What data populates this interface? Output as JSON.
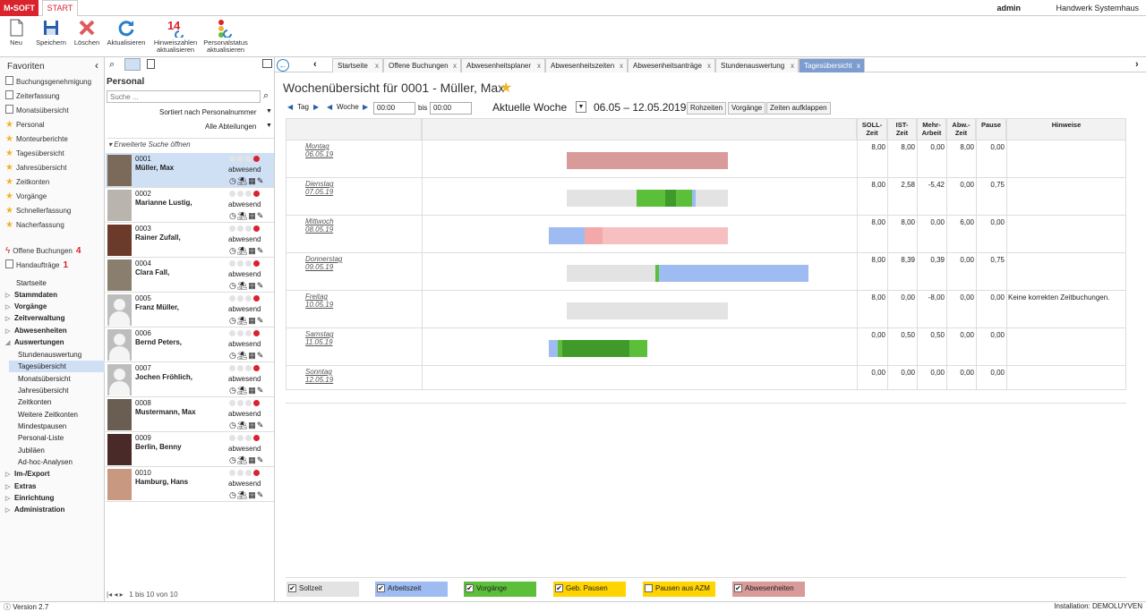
{
  "app": {
    "logo": "M•SOFT",
    "start_tab": "START",
    "user": "admin",
    "company": "Handwerk Systemhaus",
    "version": "Version 2.7",
    "installation": "Installation: DEMOLUYVEN"
  },
  "toolbar": {
    "neu": "Neu",
    "speichern": "Speichern",
    "loeschen": "Löschen",
    "aktualisieren": "Aktualisieren",
    "hinweis1": "Hinweiszahlen",
    "hinweis2": "aktualisieren",
    "pstatus1": "Personalstatus",
    "pstatus2": "aktualisieren"
  },
  "sidebar": {
    "favoriten": "Favoriten",
    "favs": [
      "Buchungsgenehmigung",
      "Zeiterfassung",
      "Monatsübersicht",
      "Personal",
      "Monteurberichte",
      "Tagesübersicht",
      "Jahresübersicht",
      "Zeitkonten",
      "Vorgänge",
      "Schnellerfassung",
      "Nacherfassung"
    ],
    "offene": "Offene Buchungen",
    "offene_count": "4",
    "hand": "Handaufträge",
    "hand_count": "1",
    "nav": [
      "Startseite",
      "Stammdaten",
      "Vorgänge",
      "Zeitverwaltung",
      "Abwesenheiten",
      "Auswertungen"
    ],
    "sub": [
      "Stundenauswertung",
      "Tagesübersicht",
      "Monatsübersicht",
      "Jahresübersicht",
      "Zeitkonten",
      "Weitere Zeitkonten",
      "Mindestpausen",
      "Personal-Liste",
      "Jubiläen",
      "Ad-hoc-Analysen"
    ],
    "nav2": [
      "Im-/Export",
      "Extras",
      "Einrichtung",
      "Administration"
    ]
  },
  "personal": {
    "title": "Personal",
    "search_placeholder": "Suche ...",
    "sort": "Sortiert nach Personalnummer",
    "dept": "Alle Abteilungen",
    "ext_search": "Erweiterte Suche öffnen",
    "pager": "1 bis 10 von 10",
    "rows": [
      {
        "num": "0001",
        "name": "Müller, Max",
        "status": "abwesend"
      },
      {
        "num": "0002",
        "name": "Marianne Lustig,",
        "status": "abwesend"
      },
      {
        "num": "0003",
        "name": "Rainer Zufall,",
        "status": "abwesend"
      },
      {
        "num": "0004",
        "name": "Clara Fall,",
        "status": "abwesend"
      },
      {
        "num": "0005",
        "name": "Franz Müller,",
        "status": "abwesend"
      },
      {
        "num": "0006",
        "name": "Bernd Peters,",
        "status": "abwesend"
      },
      {
        "num": "0007",
        "name": "Jochen Fröhlich,",
        "status": "abwesend"
      },
      {
        "num": "0008",
        "name": "Mustermann, Max",
        "status": "abwesend"
      },
      {
        "num": "0009",
        "name": "Berlin, Benny",
        "status": "abwesend"
      },
      {
        "num": "0010",
        "name": "Hamburg, Hans",
        "status": "abwesend"
      }
    ]
  },
  "tabs": [
    "Startseite",
    "Offene Buchungen",
    "Abwesenheitsplaner",
    "Abwesenheitszeiten",
    "Abwesenheitsanträge",
    "Stundenauswertung",
    "Tagesübersicht"
  ],
  "main": {
    "title": "Wochenübersicht für 0001 - Müller, Max",
    "tag": "Tag",
    "woche": "Woche",
    "from": "00:00",
    "bis": "bis",
    "to": "00:00",
    "week_label": "Aktuelle Woche",
    "range": "06.05 – 12.05.2019",
    "btn_roh": "Rohzeiten",
    "btn_vorg": "Vorgänge",
    "btn_auf": "Zeiten aufklappen"
  },
  "columns": {
    "soll": [
      "SOLL-",
      "Zeit"
    ],
    "ist": [
      "IST-",
      "Zeit"
    ],
    "mehr": [
      "Mehr-",
      "Arbeit"
    ],
    "abw": [
      "Abw.-",
      "Zeit"
    ],
    "pause": "Pause",
    "hinweise": "Hinweise"
  },
  "days": [
    {
      "day": "Montag",
      "date": "06.05.19",
      "soll": "8,00",
      "ist": "8,00",
      "mehr": "0,00",
      "abw": "8,00",
      "pause": "0,00",
      "hint": ""
    },
    {
      "day": "Dienstag",
      "date": "07.05.19",
      "soll": "8,00",
      "ist": "2,58",
      "mehr": "-5,42",
      "abw": "0,00",
      "pause": "0,75",
      "hint": ""
    },
    {
      "day": "Mittwoch",
      "date": "08.05.19",
      "soll": "8,00",
      "ist": "8,00",
      "mehr": "0,00",
      "abw": "6,00",
      "pause": "0,00",
      "hint": ""
    },
    {
      "day": "Donnerstag",
      "date": "09.05.19",
      "soll": "8,00",
      "ist": "8,39",
      "mehr": "0,39",
      "abw": "0,00",
      "pause": "0,75",
      "hint": ""
    },
    {
      "day": "Freitag",
      "date": "10.05.19",
      "soll": "8,00",
      "ist": "0,00",
      "mehr": "-8,00",
      "abw": "0,00",
      "pause": "0,00",
      "hint": "Keine korrekten Zeitbuchungen."
    },
    {
      "day": "Samstag",
      "date": "11.05.19",
      "soll": "0,00",
      "ist": "0,50",
      "mehr": "0,50",
      "abw": "0,00",
      "pause": "0,00",
      "hint": ""
    },
    {
      "day": "Sonntag",
      "date": "12.05.19",
      "soll": "0,00",
      "ist": "0,00",
      "mehr": "0,00",
      "abw": "0,00",
      "pause": "0,00",
      "hint": ""
    }
  ],
  "legend": [
    {
      "label": "Sollzeit",
      "checked": true,
      "color": "#e3e3e3"
    },
    {
      "label": "Arbeitszeit",
      "checked": true,
      "color": "#9fbcf2"
    },
    {
      "label": "Vorgänge",
      "checked": true,
      "color": "#5cbf3a"
    },
    {
      "label": "Geb. Pausen",
      "checked": true,
      "color": "#ffd400"
    },
    {
      "label": "Pausen aus AZM",
      "checked": false,
      "color": "#ffd400"
    },
    {
      "label": "Abwesenheiten",
      "checked": true,
      "color": "#d99a9a"
    }
  ]
}
